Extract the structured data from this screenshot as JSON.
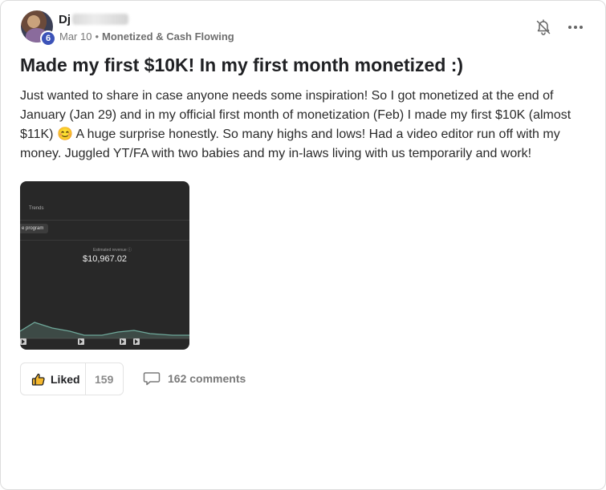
{
  "post": {
    "author_name": "Dj",
    "level": "6",
    "date": "Mar 10",
    "separator": "•",
    "category": "Monetized & Cash Flowing",
    "title": "Made my first $10K! In my first month monetized :)",
    "body": "Just wanted to share in case anyone needs some inspiration! So I got monetized at the end of January (Jan 29) and in my official first month of monetization (Feb) I made my first $10K (almost $11K) 😊 A huge surprise honestly. So many highs and lows! Had a video editor run off with my money. Juggled YT/FA with two babies and my in-laws living with us temporarily and work!"
  },
  "attachment": {
    "tab_label": "Trends",
    "chip_label": "e program",
    "revenue_label": "Estimated revenue",
    "revenue_value": "$10,967.02"
  },
  "actions": {
    "like_label": "Liked",
    "like_count": "159",
    "comments_label": "162 comments"
  },
  "icons": {
    "bell": "bell-off-icon",
    "more": "more-horizontal-icon",
    "like": "thumbs-up-icon",
    "comment": "comment-bubble-icon"
  },
  "colors": {
    "level_badge": "#3c53b8",
    "chart_line": "#6fa89a"
  }
}
